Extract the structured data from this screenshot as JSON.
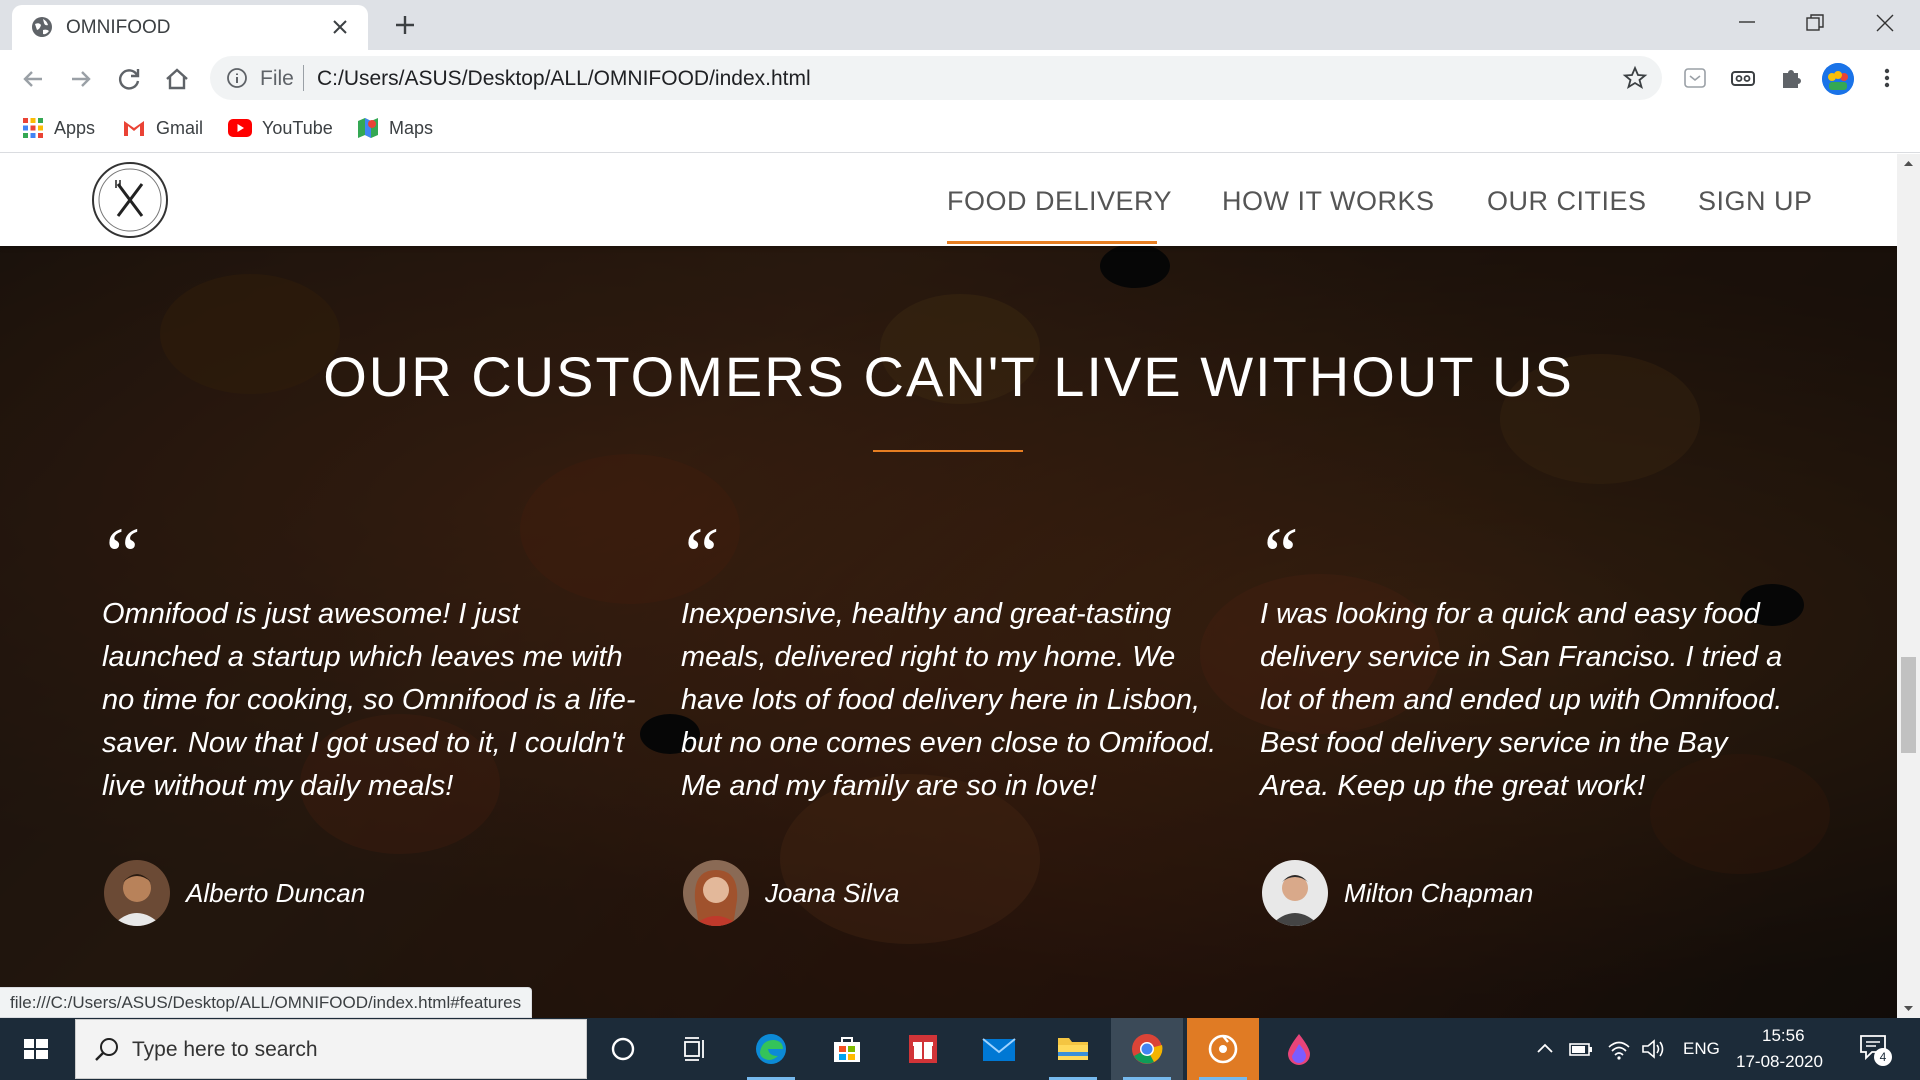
{
  "browser": {
    "tab_title": "OMNIFOOD",
    "omnibox_scheme": "File",
    "url": "C:/Users/ASUS/Desktop/ALL/OMNIFOOD/index.html",
    "bookmarks": [
      "Apps",
      "Gmail",
      "YouTube",
      "Maps"
    ],
    "status_url": "file:///C:/Users/ASUS/Desktop/ALL/OMNIFOOD/index.html#features"
  },
  "site": {
    "nav": [
      "FOOD DELIVERY",
      "HOW IT WORKS",
      "OUR CITIES",
      "SIGN UP"
    ],
    "active_nav": "FOOD DELIVERY",
    "accent_color": "#e67e22",
    "section_title": "OUR CUSTOMERS CAN'T LIVE WITHOUT US",
    "quote_mark": "“",
    "testimonials": [
      {
        "text": "Omnifood is just awesome! I just launched a startup which leaves me with no time for cooking, so Omnifood is a life-saver. Now that I got used to it, I couldn't live without my daily meals!",
        "name": "Alberto Duncan"
      },
      {
        "text": "Inexpensive, healthy and great-tasting meals, delivered right to my home. We have lots of food delivery here in Lisbon, but no one comes even close to Omifood. Me and my family are so in love!",
        "name": "Joana Silva"
      },
      {
        "text": "I was looking for a quick and easy food delivery service in San Franciso. I tried a lot of them and ended up with Omnifood. Best food delivery service in the Bay Area. Keep up the great work!",
        "name": "Milton Chapman"
      }
    ]
  },
  "taskbar": {
    "search_placeholder": "Type here to search",
    "language": "ENG",
    "time": "15:56",
    "date": "17-08-2020",
    "notification_count": "4"
  }
}
